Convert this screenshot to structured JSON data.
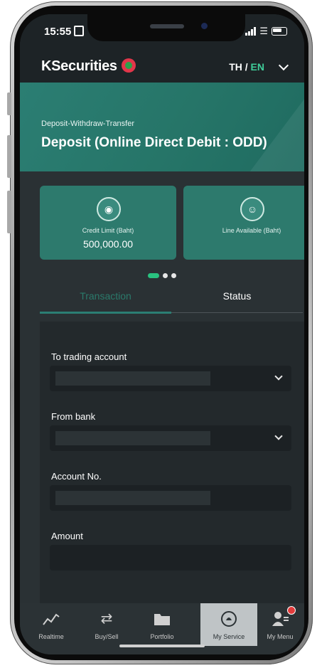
{
  "status_bar": {
    "time": "15:55"
  },
  "header": {
    "logo_text": "KSecurities",
    "lang_th": "TH",
    "lang_separator": "/",
    "lang_en": "EN",
    "active_lang_color": "#3fcd9a"
  },
  "banner": {
    "subtitle": "Deposit-Withdraw-Transfer",
    "title": "Deposit (Online Direct Debit : ODD)"
  },
  "cards": [
    {
      "label": "Credit Limit (Baht)",
      "value": "500,000.00",
      "icon": "coins-icon"
    },
    {
      "label": "Line Available (Baht)",
      "value": "",
      "icon": "hand-coin-icon"
    }
  ],
  "carousel": {
    "total_dots": 3,
    "active_index": 0
  },
  "tabs": [
    {
      "label": "Transaction",
      "active": true
    },
    {
      "label": "Status",
      "active": false
    }
  ],
  "form": {
    "trading_account_label": "To trading account",
    "from_bank_label": "From bank",
    "account_no_label": "Account No.",
    "amount_label": "Amount"
  },
  "bottom_nav": [
    {
      "label": "Realtime",
      "icon": "chart-line-icon",
      "active": false
    },
    {
      "label": "Buy/Sell",
      "icon": "arrows-swap-icon",
      "active": false
    },
    {
      "label": "Portfolio",
      "icon": "folder-icon",
      "active": false
    },
    {
      "label": "My Service",
      "icon": "service-icon",
      "active": true
    },
    {
      "label": "My Menu",
      "icon": "user-menu-icon",
      "active": false,
      "badge": true
    }
  ],
  "colors": {
    "brand_green": "#2b7e73",
    "badge_red": "#e23b3b",
    "dot_active": "#29c27f"
  }
}
